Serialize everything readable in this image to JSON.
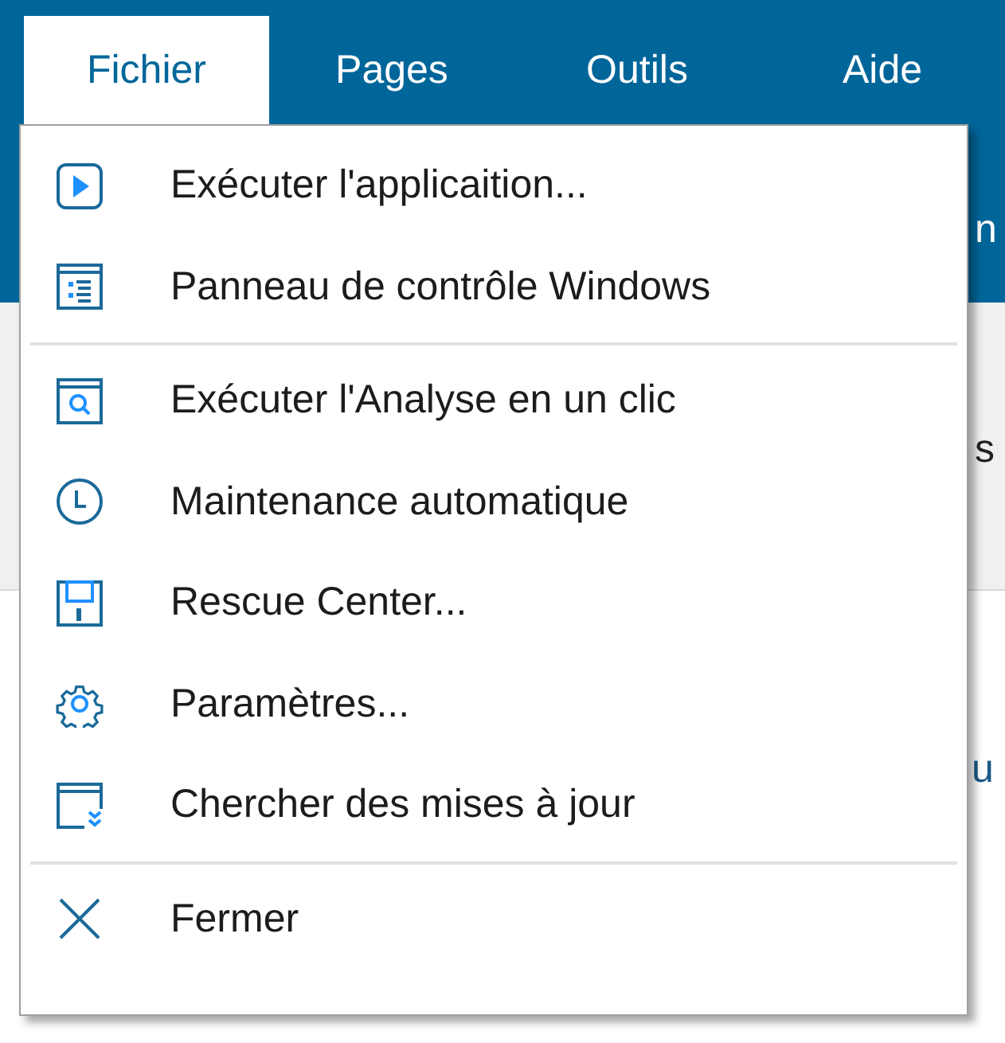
{
  "menu_bar": [
    {
      "label": "Fichier",
      "selected": true
    },
    {
      "label": "Pages",
      "selected": false
    },
    {
      "label": "Outils",
      "selected": false
    },
    {
      "label": "Aide",
      "selected": false
    }
  ],
  "background_fragments": [
    "n",
    "s",
    "u"
  ],
  "menu": {
    "groups": [
      [
        {
          "label": "Exécuter l'applicaition..."
        },
        {
          "label": "Panneau de contrôle Windows"
        }
      ],
      [
        {
          "label": "Exécuter l'Analyse en un clic"
        },
        {
          "label": "Maintenance automatique"
        },
        {
          "label": "Rescue Center..."
        },
        {
          "label": "Paramètres..."
        },
        {
          "label": "Chercher des mises à jour"
        }
      ],
      [
        {
          "label": "Fermer"
        }
      ]
    ]
  }
}
